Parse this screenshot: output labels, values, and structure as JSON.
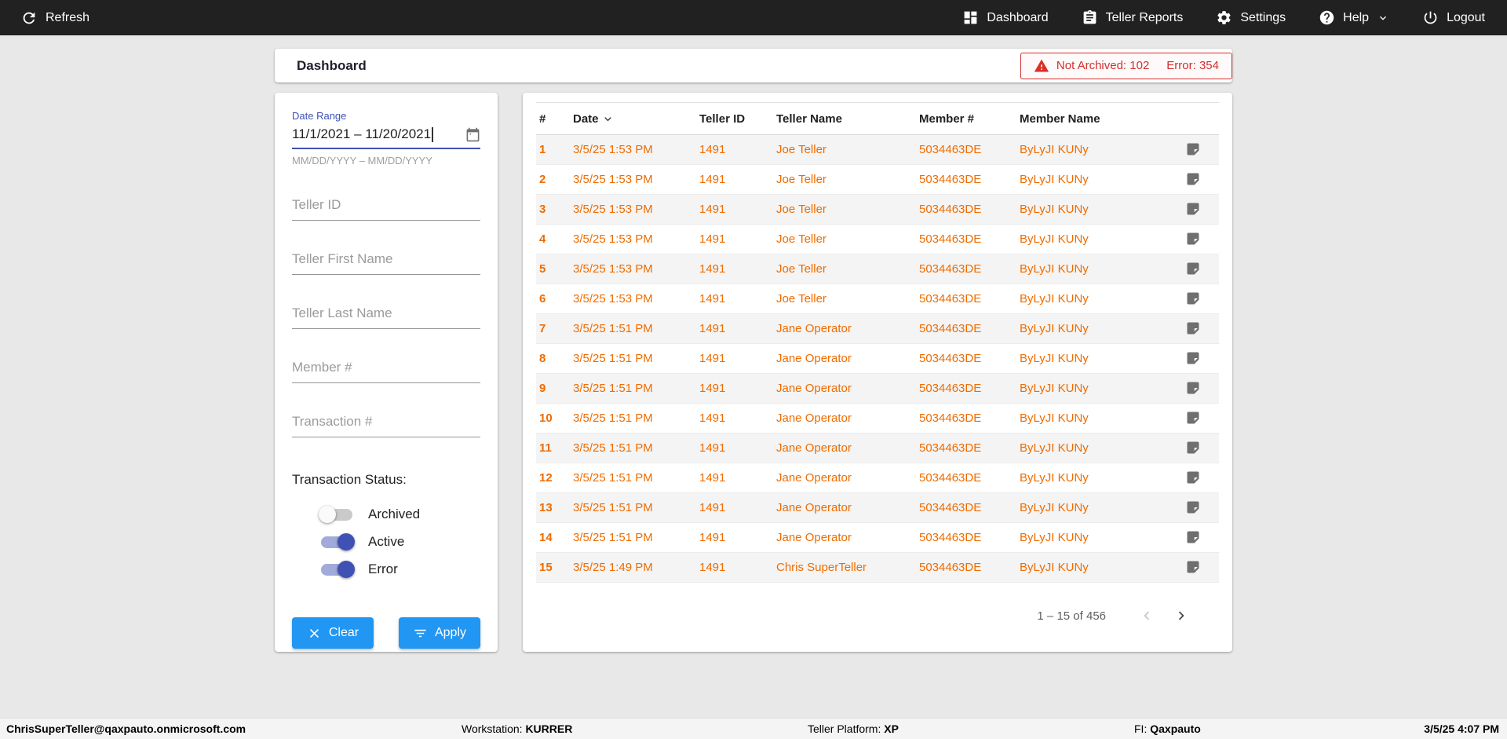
{
  "colors": {
    "topbar_bg": "#212121",
    "accent_blue": "#2196F3",
    "indigo": "#3F51B5",
    "row_text_orange": "#EF6C00",
    "alert_red": "#D32F2F"
  },
  "topbar": {
    "refresh": "Refresh",
    "dashboard": "Dashboard",
    "teller_reports": "Teller Reports",
    "settings": "Settings",
    "help": "Help",
    "logout": "Logout"
  },
  "header": {
    "title": "Dashboard",
    "alert": {
      "not_archived": "Not Archived: 102",
      "error": "Error: 354"
    }
  },
  "filters": {
    "date_range_label": "Date Range",
    "date_range_value": "11/1/2021 – 11/20/2021",
    "date_range_hint": "MM/DD/YYYY – MM/DD/YYYY",
    "teller_id_placeholder": "Teller ID",
    "teller_first_name_placeholder": "Teller First Name",
    "teller_last_name_placeholder": "Teller Last Name",
    "member_placeholder": "Member #",
    "transaction_placeholder": "Transaction #",
    "status_label": "Transaction Status:",
    "toggles": [
      {
        "label": "Archived",
        "on": false
      },
      {
        "label": "Active",
        "on": true
      },
      {
        "label": "Error",
        "on": true
      }
    ],
    "clear": "Clear",
    "apply": "Apply"
  },
  "table": {
    "columns": {
      "num": "#",
      "date": "Date",
      "teller_id": "Teller ID",
      "teller_name": "Teller Name",
      "member": "Member #",
      "member_name": "Member Name"
    },
    "rows": [
      {
        "num": "1",
        "date": "3/5/25 1:53 PM",
        "teller_id": "1491",
        "teller_name": "Joe Teller",
        "member": "5034463DE",
        "member_name": "ByLyJI KUNy"
      },
      {
        "num": "2",
        "date": "3/5/25 1:53 PM",
        "teller_id": "1491",
        "teller_name": "Joe Teller",
        "member": "5034463DE",
        "member_name": "ByLyJI KUNy"
      },
      {
        "num": "3",
        "date": "3/5/25 1:53 PM",
        "teller_id": "1491",
        "teller_name": "Joe Teller",
        "member": "5034463DE",
        "member_name": "ByLyJI KUNy"
      },
      {
        "num": "4",
        "date": "3/5/25 1:53 PM",
        "teller_id": "1491",
        "teller_name": "Joe Teller",
        "member": "5034463DE",
        "member_name": "ByLyJI KUNy"
      },
      {
        "num": "5",
        "date": "3/5/25 1:53 PM",
        "teller_id": "1491",
        "teller_name": "Joe Teller",
        "member": "5034463DE",
        "member_name": "ByLyJI KUNy"
      },
      {
        "num": "6",
        "date": "3/5/25 1:53 PM",
        "teller_id": "1491",
        "teller_name": "Joe Teller",
        "member": "5034463DE",
        "member_name": "ByLyJI KUNy"
      },
      {
        "num": "7",
        "date": "3/5/25 1:51 PM",
        "teller_id": "1491",
        "teller_name": "Jane Operator",
        "member": "5034463DE",
        "member_name": "ByLyJI KUNy"
      },
      {
        "num": "8",
        "date": "3/5/25 1:51 PM",
        "teller_id": "1491",
        "teller_name": "Jane Operator",
        "member": "5034463DE",
        "member_name": "ByLyJI KUNy"
      },
      {
        "num": "9",
        "date": "3/5/25 1:51 PM",
        "teller_id": "1491",
        "teller_name": "Jane Operator",
        "member": "5034463DE",
        "member_name": "ByLyJI KUNy"
      },
      {
        "num": "10",
        "date": "3/5/25 1:51 PM",
        "teller_id": "1491",
        "teller_name": "Jane Operator",
        "member": "5034463DE",
        "member_name": "ByLyJI KUNy"
      },
      {
        "num": "11",
        "date": "3/5/25 1:51 PM",
        "teller_id": "1491",
        "teller_name": "Jane Operator",
        "member": "5034463DE",
        "member_name": "ByLyJI KUNy"
      },
      {
        "num": "12",
        "date": "3/5/25 1:51 PM",
        "teller_id": "1491",
        "teller_name": "Jane Operator",
        "member": "5034463DE",
        "member_name": "ByLyJI KUNy"
      },
      {
        "num": "13",
        "date": "3/5/25 1:51 PM",
        "teller_id": "1491",
        "teller_name": "Jane Operator",
        "member": "5034463DE",
        "member_name": "ByLyJI KUNy"
      },
      {
        "num": "14",
        "date": "3/5/25 1:51 PM",
        "teller_id": "1491",
        "teller_name": "Jane Operator",
        "member": "5034463DE",
        "member_name": "ByLyJI KUNy"
      },
      {
        "num": "15",
        "date": "3/5/25 1:49 PM",
        "teller_id": "1491",
        "teller_name": "Chris SuperTeller",
        "member": "5034463DE",
        "member_name": "ByLyJI KUNy"
      }
    ],
    "pagination": {
      "range": "1 – 15 of 456"
    }
  },
  "footer": {
    "user": "ChrisSuperTeller@qaxpauto.onmicrosoft.com",
    "workstation_label": "Workstation: ",
    "workstation": "KURRER",
    "platform_label": "Teller Platform: ",
    "platform": "XP",
    "fi_label": "FI: ",
    "fi": "Qaxpauto",
    "datetime": "3/5/25 4:07 PM"
  }
}
